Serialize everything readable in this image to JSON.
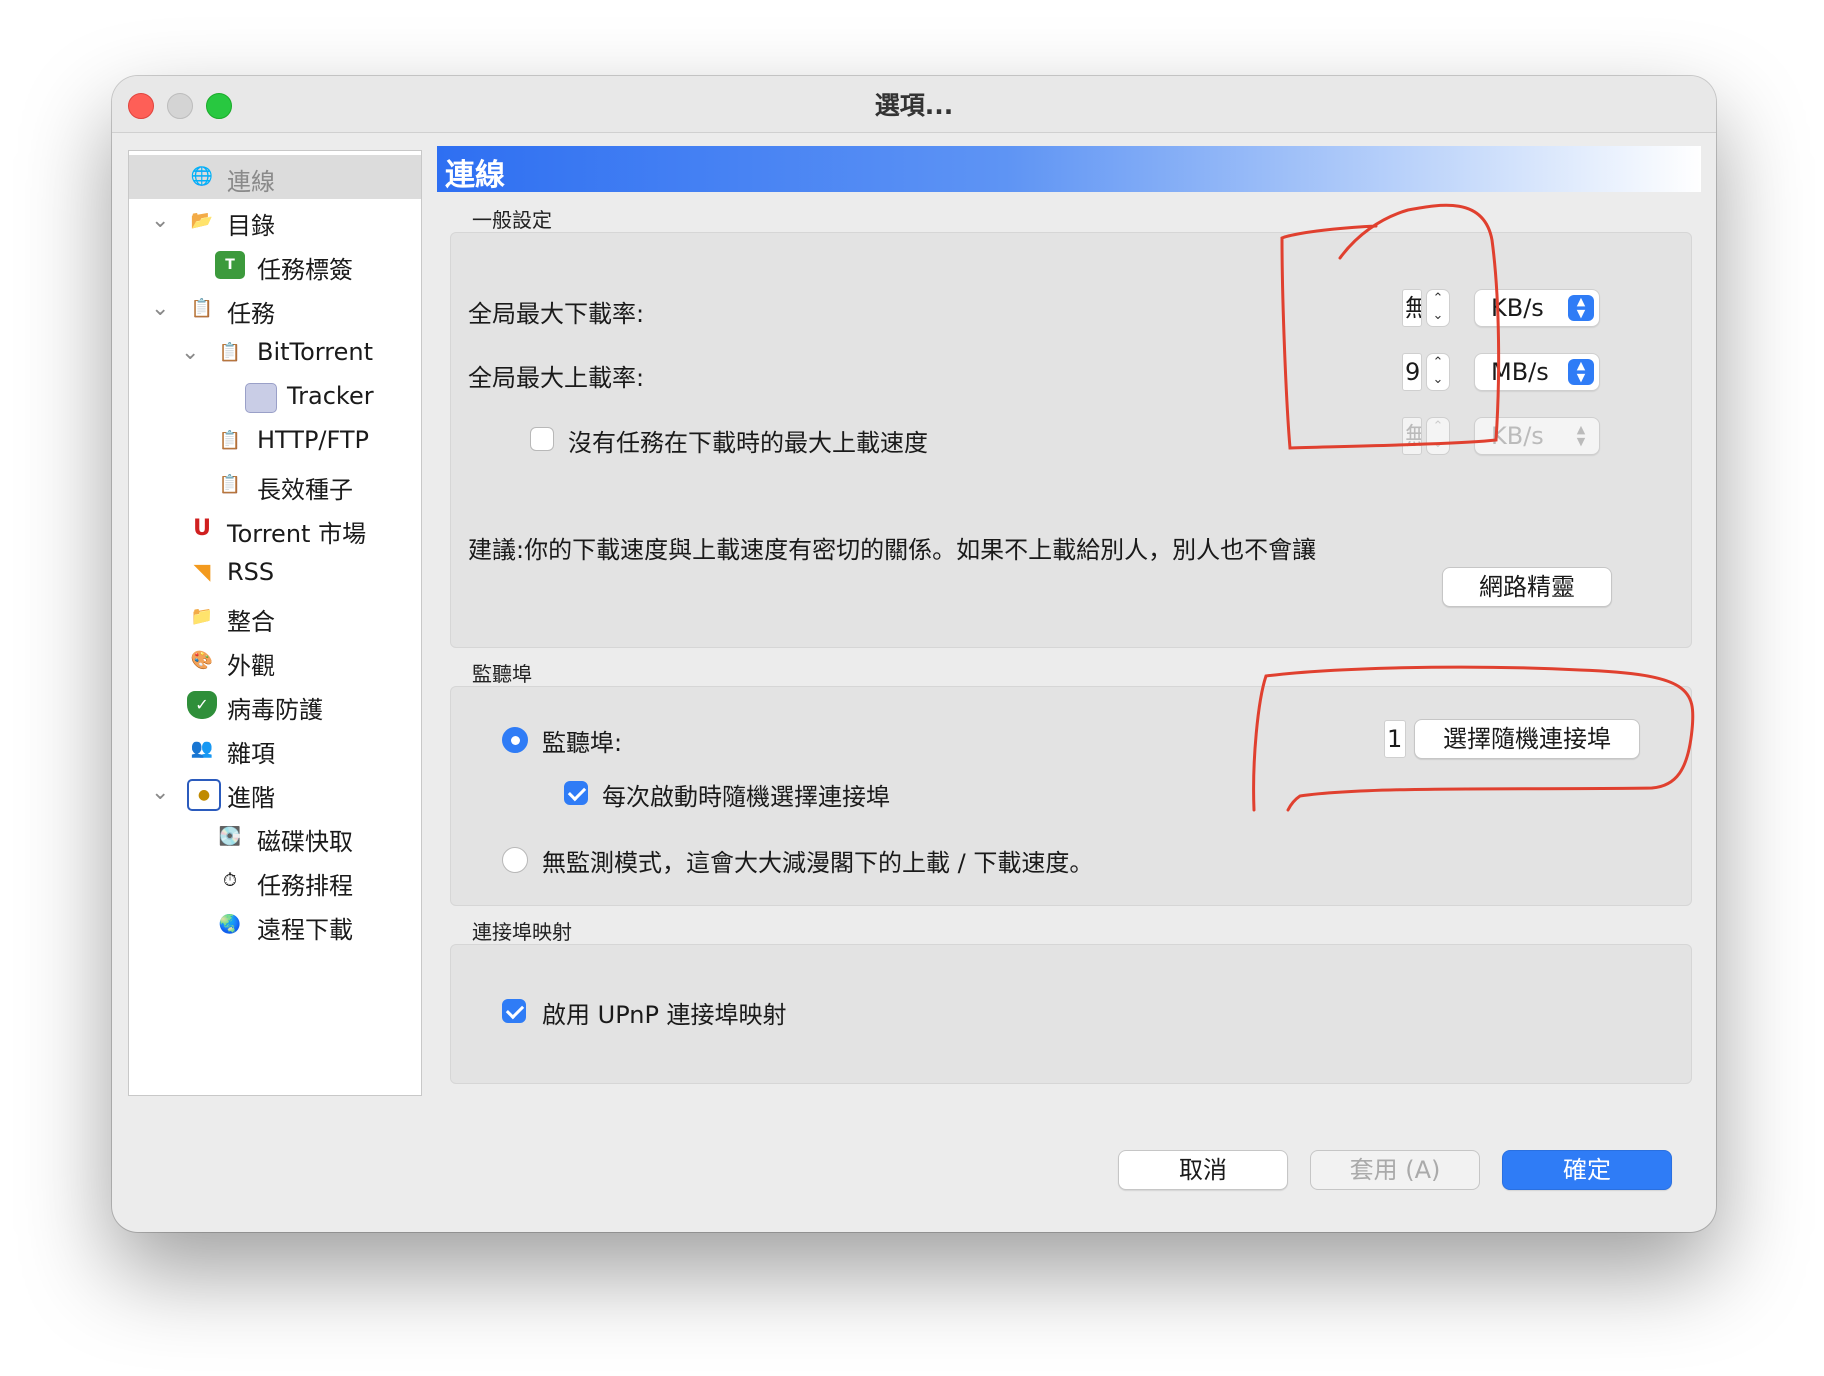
{
  "window": {
    "title": "選項..."
  },
  "sidebar": {
    "items": [
      {
        "label": "連線",
        "icon": "globe-network-icon",
        "selected": true
      },
      {
        "label": "目錄",
        "icon": "folder-icon",
        "expandable": true
      },
      {
        "label": "任務標簽",
        "icon": "tag-icon"
      },
      {
        "label": "任務",
        "icon": "task-clipboard-icon",
        "expandable": true
      },
      {
        "label": "BitTorrent",
        "icon": "task-clipboard-icon",
        "expandable": true
      },
      {
        "label": "Tracker",
        "icon": "server-box-icon"
      },
      {
        "label": "HTTP/FTP",
        "icon": "task-clipboard-icon"
      },
      {
        "label": "長效種子",
        "icon": "task-clipboard-icon"
      },
      {
        "label": "Torrent 市場",
        "icon": "magnet-icon"
      },
      {
        "label": "RSS",
        "icon": "rss-icon"
      },
      {
        "label": "整合",
        "icon": "integration-folder-icon"
      },
      {
        "label": "外觀",
        "icon": "appearance-icon"
      },
      {
        "label": "病毒防護",
        "icon": "shield-icon"
      },
      {
        "label": "雜項",
        "icon": "people-icon"
      },
      {
        "label": "進階",
        "icon": "advanced-window-icon",
        "expandable": true
      },
      {
        "label": "磁碟快取",
        "icon": "disk-cache-icon"
      },
      {
        "label": "任務排程",
        "icon": "scheduler-icon"
      },
      {
        "label": "遠程下載",
        "icon": "globe-icon"
      }
    ]
  },
  "main": {
    "header": "連線",
    "general": {
      "group_label": "一般設定",
      "max_download_label": "全局最大下載率:",
      "max_download_value": "無",
      "max_download_unit": "KB/s",
      "max_upload_label": "全局最大上載率:",
      "max_upload_value": "9",
      "max_upload_unit": "MB/s",
      "idle_upload_checkbox_label": "沒有任務在下載時的最大上載速度",
      "idle_upload_checked": false,
      "idle_upload_value": "無",
      "idle_upload_unit": "KB/s",
      "advice_text": "建議:你的下載速度與上載速度有密切的關係。如果不上載給別人，別人也不會讓",
      "network_wizard_button": "網路精靈"
    },
    "listen_port": {
      "group_label": "監聽埠",
      "listen_radio_label": "監聽埠:",
      "listen_radio_selected": true,
      "port_value": "1",
      "random_port_button": "選擇隨機連接埠",
      "random_each_start_label": "每次啟動時隨機選擇連接埠",
      "random_each_start_checked": true,
      "no_listen_radio_label": "無監測模式，這會大大減漫閣下的上載 / 下載速度。",
      "no_listen_radio_selected": false
    },
    "port_mapping": {
      "group_label": "連接埠映射",
      "upnp_label": "啟用 UPnP 連接埠映射",
      "upnp_checked": true
    }
  },
  "footer": {
    "cancel_label": "取消",
    "apply_label": "套用 (A)",
    "ok_label": "確定"
  },
  "colors": {
    "accent": "#2f7cf6",
    "annotation": "#e0402f",
    "close": "#fe5f57",
    "maximize": "#28c840"
  }
}
